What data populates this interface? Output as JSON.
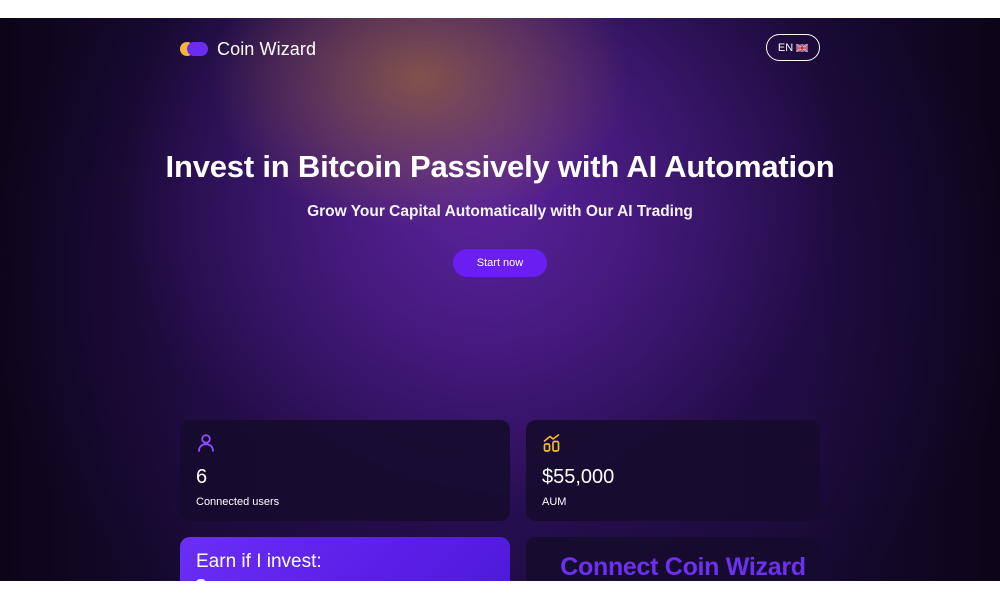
{
  "header": {
    "brand": "Coin Wizard",
    "language_label": "EN",
    "language_flag_icon": "uk-flag-icon"
  },
  "hero": {
    "title": "Invest in Bitcoin Passively with AI Automation",
    "subtitle": "Grow Your Capital Automatically with Our AI Trading",
    "cta_label": "Start now"
  },
  "stats": {
    "users": {
      "icon": "user-icon",
      "value": "6",
      "label": "Connected users"
    },
    "aum": {
      "icon": "growth-chart-icon",
      "value": "$55,000",
      "label": "AUM"
    }
  },
  "earn": {
    "title": "Earn if I invest:"
  },
  "connect": {
    "title": "Connect Coin Wizard"
  },
  "colors": {
    "background": "#100722",
    "accent": "#6a1ef2",
    "logo_yellow": "#f3b63a",
    "logo_purple": "#6a2cf5",
    "icon_purple": "#8b4dff",
    "icon_yellow": "#f5b930"
  }
}
